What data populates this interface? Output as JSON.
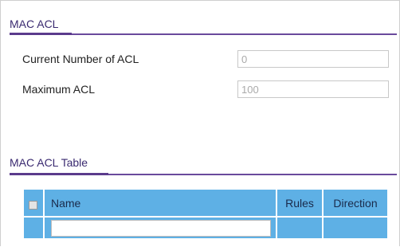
{
  "mac_acl": {
    "title": "MAC ACL",
    "current_number_label": "Current Number of ACL",
    "current_number_value": "0",
    "maximum_label": "Maximum ACL",
    "maximum_value": "100"
  },
  "mac_acl_table": {
    "title": "MAC ACL Table",
    "columns": [
      "Name",
      "Rules",
      "Direction"
    ],
    "new_row": {
      "name_value": ""
    }
  },
  "colors": {
    "section_title": "#3a2a70",
    "section_rule": "#6a4a9c",
    "table_header_bg": "#5eb0e5",
    "input_border": "#c8c8c8"
  },
  "icons": {
    "select_all": "checkbox-icon"
  }
}
